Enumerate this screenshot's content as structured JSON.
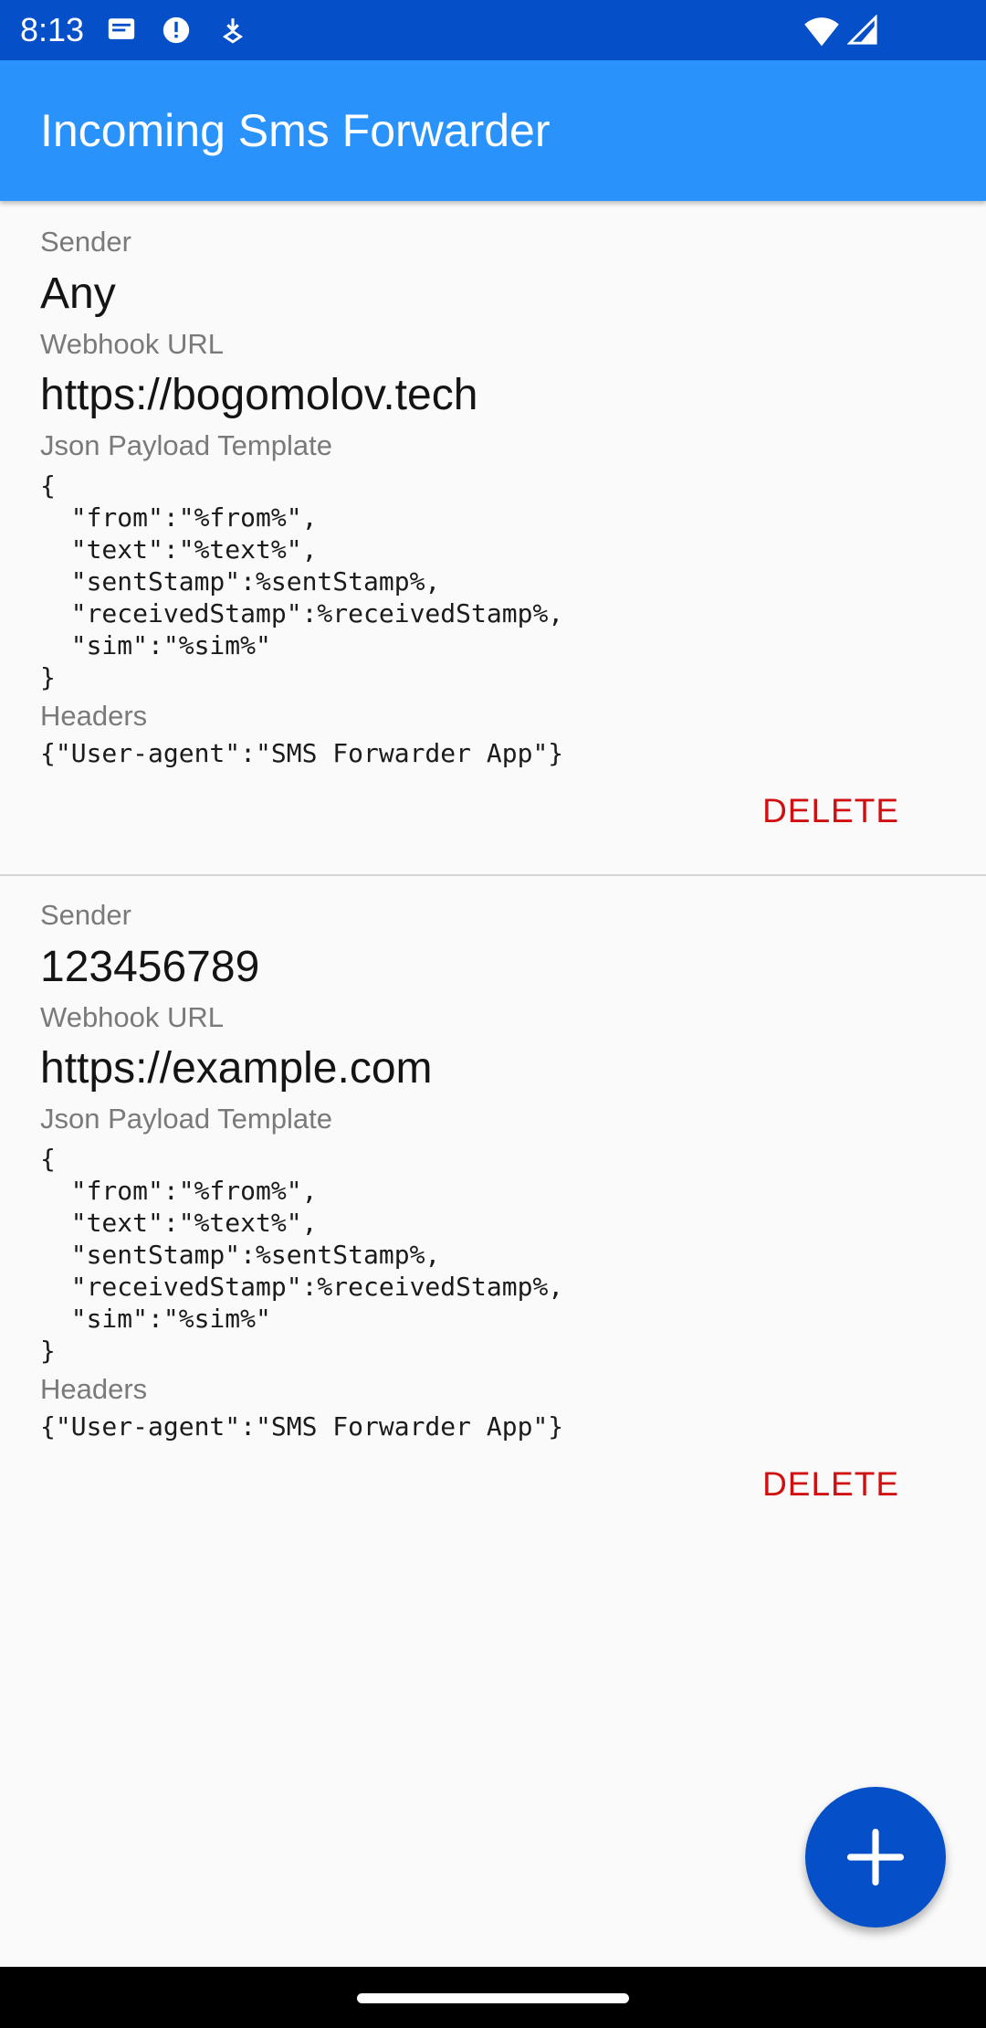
{
  "status_bar": {
    "time": "8:13",
    "icons": [
      "message-icon",
      "alert-icon",
      "download-icon",
      "wifi-icon",
      "signal-icon"
    ]
  },
  "app_bar": {
    "title": "Incoming Sms Forwarder"
  },
  "colors": {
    "status_bar": "#0550c8",
    "app_bar": "#2a93fb",
    "delete": "#d01010",
    "fab": "#0550c8"
  },
  "labels": {
    "sender": "Sender",
    "webhook_url": "Webhook URL",
    "json_payload_template": "Json Payload Template",
    "headers": "Headers",
    "delete": "DELETE"
  },
  "forwarders": [
    {
      "sender": "Any",
      "webhook_url": "https://bogomolov.tech",
      "json_payload_template": "{\n  \"from\":\"%from%\",\n  \"text\":\"%text%\",\n  \"sentStamp\":%sentStamp%,\n  \"receivedStamp\":%receivedStamp%,\n  \"sim\":\"%sim%\"\n}",
      "headers": "{\"User-agent\":\"SMS Forwarder App\"}"
    },
    {
      "sender": "123456789",
      "webhook_url": "https://example.com",
      "json_payload_template": "{\n  \"from\":\"%from%\",\n  \"text\":\"%text%\",\n  \"sentStamp\":%sentStamp%,\n  \"receivedStamp\":%receivedStamp%,\n  \"sim\":\"%sim%\"\n}",
      "headers": "{\"User-agent\":\"SMS Forwarder App\"}"
    }
  ],
  "fab": {
    "icon": "plus-icon"
  }
}
